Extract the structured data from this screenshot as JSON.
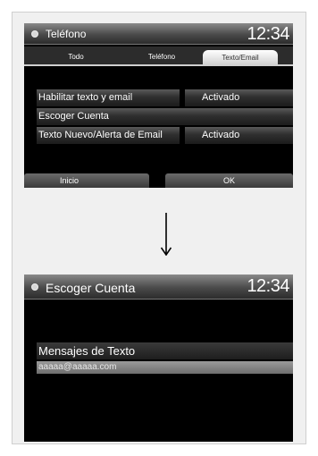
{
  "screen1": {
    "title": "Teléfono",
    "clock": "12:34",
    "tabs": [
      {
        "label": "Todo"
      },
      {
        "label": "Teléfono"
      },
      {
        "label": "Texto/Email"
      }
    ],
    "rows": [
      {
        "label": "Habilitar texto y email",
        "value": "Activado"
      },
      {
        "label": "Escoger Cuenta",
        "value": ""
      },
      {
        "label": "Texto Nuevo/Alerta de Email",
        "value": "Activado"
      }
    ],
    "buttons": {
      "home": "Inicio",
      "ok": "OK"
    }
  },
  "screen2": {
    "title": "Escoger Cuenta",
    "clock": "12:34",
    "items": [
      {
        "label": "Mensajes de Texto"
      },
      {
        "label": "aaaaa@aaaaa.com"
      }
    ]
  }
}
